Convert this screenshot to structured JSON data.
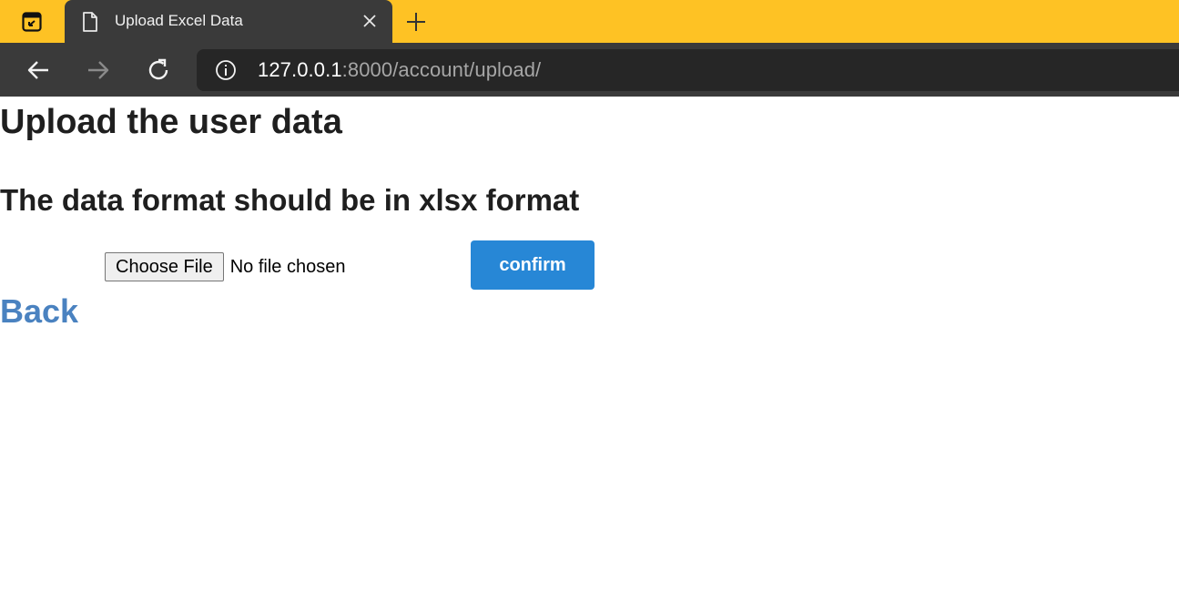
{
  "browser": {
    "tab": {
      "title": "Upload Excel Data"
    },
    "address_bar": {
      "host": "127.0.0.1",
      "path": ":8000/account/upload/"
    },
    "colors": {
      "tabstrip": "#fec224",
      "toolbar": "#3a3a3a",
      "omnibox": "#262626"
    }
  },
  "page": {
    "heading": "Upload the user data",
    "subheading": "The data format should be in xlsx format",
    "file_input": {
      "button_label": "Choose File",
      "status": "No file chosen"
    },
    "confirm_label": "confirm",
    "back_label": "Back",
    "colors": {
      "confirm_button": "#2787d6",
      "back_link": "#4a82c0"
    }
  }
}
